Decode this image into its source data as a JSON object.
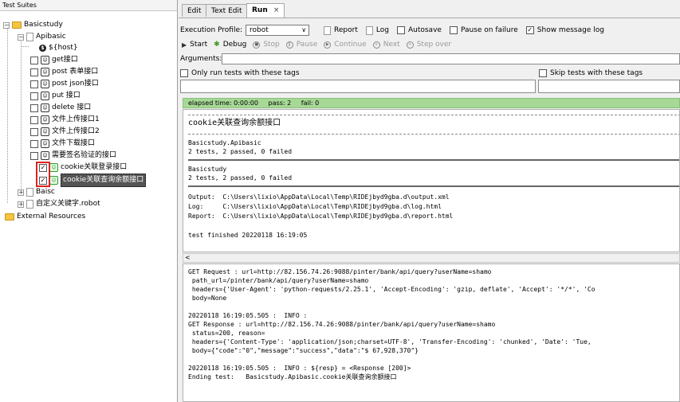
{
  "tree": {
    "header": "Test Suites",
    "suite": "Basicstudy",
    "apibasic": "Apibasic",
    "host": "${host}",
    "tests": [
      {
        "label": "get接口",
        "checked": false
      },
      {
        "label": "post 表单接口",
        "checked": false
      },
      {
        "label": "post json接口",
        "checked": false
      },
      {
        "label": "put 接口",
        "checked": false
      },
      {
        "label": "delete 接口",
        "checked": false
      },
      {
        "label": "文件上传接口1",
        "checked": false
      },
      {
        "label": "文件上传接口2",
        "checked": false
      },
      {
        "label": "文件下载接口",
        "checked": false
      },
      {
        "label": "需要签名验证的接口",
        "checked": false
      },
      {
        "label": "cookie关联登录接口",
        "checked": true
      },
      {
        "label": "cookie关联查询余额接口",
        "checked": true
      }
    ],
    "baisc": "Baisc",
    "keyword": "自定义关键字.robot",
    "external": "External Resources",
    "check_mark": "✓",
    "expand_minus": "−",
    "expand_plus": "+",
    "dollar_glyph": "$",
    "test_glyph": "☺"
  },
  "tabs": {
    "edit": "Edit",
    "text_edit": "Text Edit",
    "run": "Run",
    "close": "×"
  },
  "toolbar": {
    "profile_label": "Execution Profile:",
    "profile_value": "robot",
    "dropdown_arrow": "∨",
    "report": "Report",
    "log": "Log",
    "autosave": "Autosave",
    "pause_on_failure": "Pause on failure",
    "show_message_log": "Show message log",
    "start": "Start",
    "debug": "Debug",
    "stop": "Stop",
    "pause": "Pause",
    "continue": "Continue",
    "next": "Next",
    "step_over": "Step over",
    "arguments": "Arguments:",
    "only_run_tags": "Only run tests with these tags",
    "skip_tags": "Skip tests with these tags"
  },
  "status": {
    "elapsed": "elapsed time: 0:00:00",
    "pass": "pass: 2",
    "fail": "fail: 0"
  },
  "output": {
    "test_name": "cookie关联查询余额接口",
    "suite1": "Basicstudy.Apibasic",
    "suite1_result": "2 tests, 2 passed, 0 failed",
    "suite2": "Basicstudy",
    "suite2_result": "2 tests, 2 passed, 0 failed",
    "output_line": "Output:  C:\\Users\\lixio\\AppData\\Local\\Temp\\RIDEjbyd9gba.d\\output.xml",
    "log_line": "Log:     C:\\Users\\lixio\\AppData\\Local\\Temp\\RIDEjbyd9gba.d\\log.html",
    "report_line": "Report:  C:\\Users\\lixio\\AppData\\Local\\Temp\\RIDEjbyd9gba.d\\report.html",
    "finished": "test finished 20220118 16:19:05"
  },
  "scroll_left": "<",
  "messages": [
    "GET Request : url=http://82.156.74.26:9088/pinter/bank/api/query?userName=shamo",
    " path_url=/pinter/bank/api/query?userName=shamo",
    " headers={'User-Agent': 'python-requests/2.25.1', 'Accept-Encoding': 'gzip, deflate', 'Accept': '*/*', 'Co",
    " body=None",
    "",
    "20220118 16:19:05.505 :  INFO :",
    "GET Response : url=http://82.156.74.26:9088/pinter/bank/api/query?userName=shamo",
    " status=200, reason=",
    " headers={'Content-Type': 'application/json;charset=UTF-8', 'Transfer-Encoding': 'chunked', 'Date': 'Tue,",
    " body={\"code\":\"0\",\"message\":\"success\",\"data\":\"$ 67,928,370\"}",
    "",
    "20220118 16:19:05.505 :  INFO : ${resp} = <Response [200]>",
    "Ending test:   Basicstudy.Apibasic.cookie关联查询余额接口"
  ],
  "colors": {
    "pass_bar": "#a6d896",
    "highlight": "#e02020"
  }
}
